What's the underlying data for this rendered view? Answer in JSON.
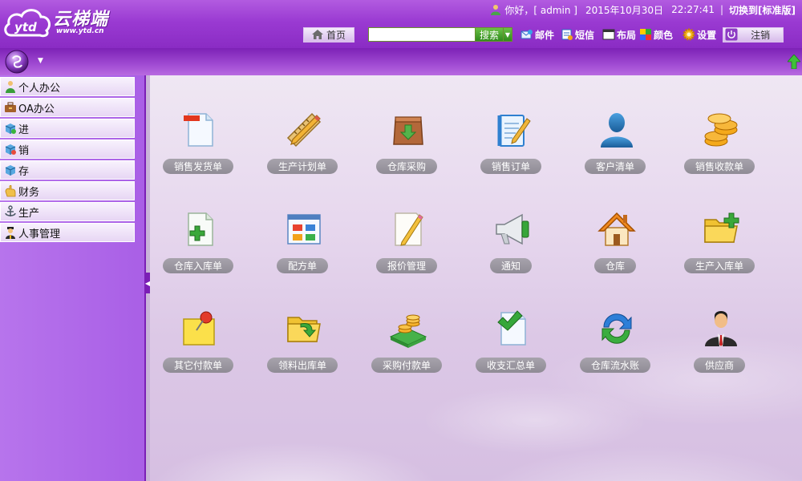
{
  "header": {
    "logo_name": "云梯端",
    "logo_url": "www.ytd.cn",
    "greeting": "你好，[ admin ]",
    "date": "2015年10月30日",
    "time": "22:27:41",
    "separator": "|",
    "switch_label": "切换到[标准版]"
  },
  "toolbar": {
    "home_label": "首页",
    "search_value": "",
    "search_button": "搜索",
    "mail_label": "邮件",
    "sms_label": "短信",
    "layout_label": "布局",
    "color_label": "颜色",
    "settings_label": "设置",
    "logout_label": "注销"
  },
  "sidebar": {
    "items": [
      {
        "label": "个人办公",
        "icon": "person-icon"
      },
      {
        "label": "OA办公",
        "icon": "briefcase-icon"
      },
      {
        "label": "进",
        "icon": "cube-in-icon"
      },
      {
        "label": "销",
        "icon": "cube-out-icon"
      },
      {
        "label": "存",
        "icon": "cube-icon"
      },
      {
        "label": "财务",
        "icon": "hand-coins-icon"
      },
      {
        "label": "生产",
        "icon": "anchor-icon"
      },
      {
        "label": "人事管理",
        "icon": "staff-icon"
      }
    ]
  },
  "tiles": [
    {
      "label": "销售发货单",
      "icon": "document-minus-icon"
    },
    {
      "label": "生产计划单",
      "icon": "ruler-pencil-icon"
    },
    {
      "label": "仓库采购",
      "icon": "box-download-icon"
    },
    {
      "label": "销售订单",
      "icon": "notepad-pen-icon"
    },
    {
      "label": "客户清单",
      "icon": "user-silhouette-icon"
    },
    {
      "label": "销售收款单",
      "icon": "coins-icon"
    },
    {
      "label": "仓库入库单",
      "icon": "document-plus-icon"
    },
    {
      "label": "配方单",
      "icon": "window-grid-icon"
    },
    {
      "label": "报价管理",
      "icon": "paper-pencil-icon"
    },
    {
      "label": "通知",
      "icon": "megaphone-icon"
    },
    {
      "label": "仓库",
      "icon": "house-icon"
    },
    {
      "label": "生产入库单",
      "icon": "folder-plus-icon"
    },
    {
      "label": "其它付款单",
      "icon": "note-pin-icon"
    },
    {
      "label": "领料出库单",
      "icon": "folder-arrow-icon"
    },
    {
      "label": "采购付款单",
      "icon": "money-stack-icon"
    },
    {
      "label": "收支汇总单",
      "icon": "document-check-icon"
    },
    {
      "label": "仓库流水账",
      "icon": "refresh-icon"
    },
    {
      "label": "供应商",
      "icon": "businessman-icon"
    }
  ]
}
